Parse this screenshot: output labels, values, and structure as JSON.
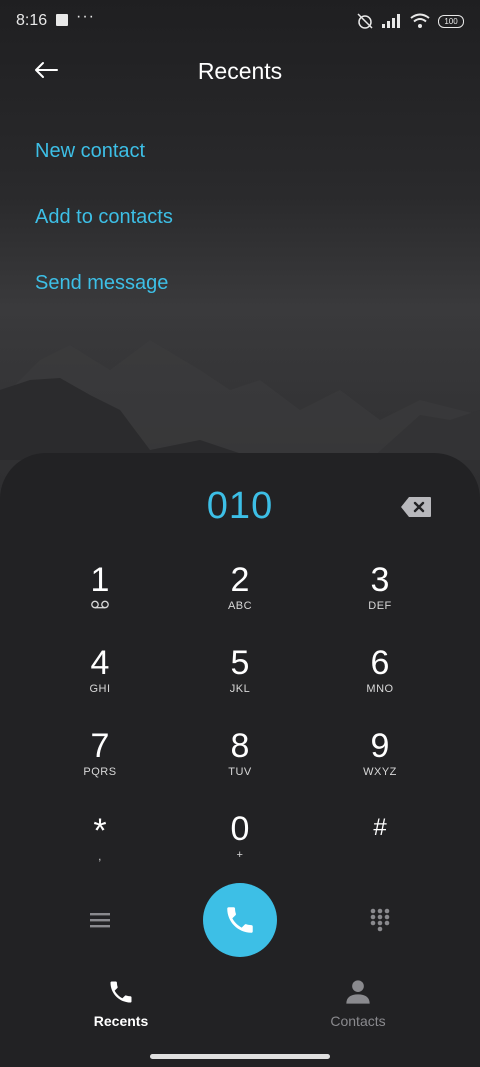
{
  "status_bar": {
    "time": "8:16",
    "dots": "···",
    "battery": "100"
  },
  "header": {
    "title": "Recents"
  },
  "menu": [
    "New contact",
    "Add to contacts",
    "Send message"
  ],
  "dialpad": {
    "number": "010",
    "keys": [
      {
        "digit": "1",
        "letters": ""
      },
      {
        "digit": "2",
        "letters": "ABC"
      },
      {
        "digit": "3",
        "letters": "DEF"
      },
      {
        "digit": "4",
        "letters": "GHI"
      },
      {
        "digit": "5",
        "letters": "JKL"
      },
      {
        "digit": "6",
        "letters": "MNO"
      },
      {
        "digit": "7",
        "letters": "PQRS"
      },
      {
        "digit": "8",
        "letters": "TUV"
      },
      {
        "digit": "9",
        "letters": "WXYZ"
      },
      {
        "digit": "*",
        "letters": ","
      },
      {
        "digit": "0",
        "letters": "+"
      },
      {
        "digit": "#",
        "letters": ""
      }
    ]
  },
  "tabs": [
    {
      "label": "Recents",
      "icon": "phone-icon",
      "active": true
    },
    {
      "label": "Contacts",
      "icon": "person-icon",
      "active": false
    }
  ],
  "colors": {
    "accent": "#3dbfe6",
    "background": "#1c1c1e",
    "pad": "#222224",
    "inactive": "#8a8a8e"
  }
}
